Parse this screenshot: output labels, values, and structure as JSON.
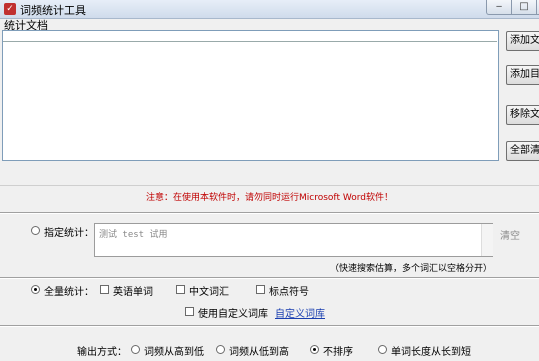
{
  "window": {
    "title": "词频统计工具",
    "controls": {
      "minimize": "‒",
      "maximize": "□",
      "close": "✕"
    }
  },
  "files": {
    "label": "统计文档",
    "buttons": {
      "add_file": "添加文件",
      "add_folder": "添加目录",
      "remove_file": "移除文件",
      "clear_all": "全部清空"
    }
  },
  "notice": "注意：在使用本软件时，请勿同时运行Microsoft Word软件！",
  "specified": {
    "label": "指定统计：",
    "input_value": "测试 test 试用",
    "clear": "清空",
    "hint": "（快速搜索估算，多个词汇以空格分开）"
  },
  "full": {
    "label": "全量统计：",
    "options": {
      "english": "英语单词",
      "chinese": "中文词汇",
      "punct": "标点符号",
      "custom_lib": "使用自定义词库"
    },
    "custom_link": "自定义词库"
  },
  "output": {
    "label": "输出方式：",
    "options": {
      "high_low": "词频从高到低",
      "low_high": "词频从低到高",
      "no_sort": "不排序",
      "length": "单词长度从长到短"
    },
    "selected": "no_sort"
  },
  "colors": {
    "notice": "#c00000",
    "link": "#1a3fb0"
  }
}
